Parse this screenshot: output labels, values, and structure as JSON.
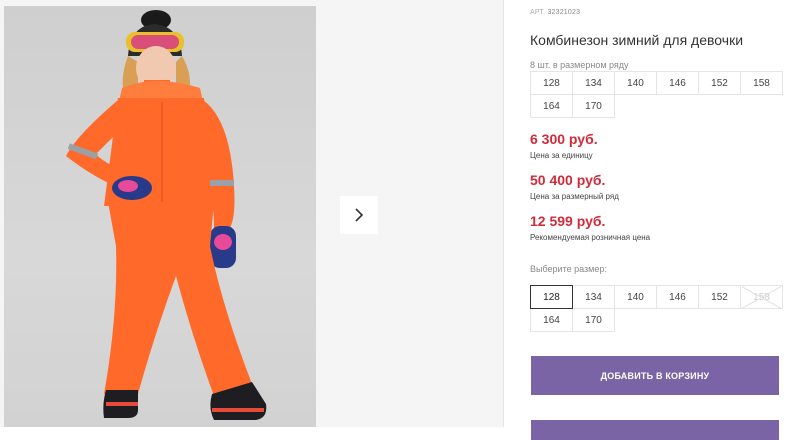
{
  "gallery": {
    "photo_alt": "",
    "next_icon": "chevron-right-icon"
  },
  "product": {
    "article_label": "АРТ.",
    "article_number": "32321023",
    "title": "Комбинезон зимний для девочки",
    "size_run_label": "8 шт. в размерном ряду",
    "size_run": [
      "128",
      "134",
      "140",
      "146",
      "152",
      "158",
      "164",
      "170"
    ]
  },
  "prices": [
    {
      "value": "6 300 руб.",
      "note": "Цена за единицу"
    },
    {
      "value": "50 400 руб.",
      "note": "Цена за размерный ряд"
    },
    {
      "value": "12 599 руб.",
      "note": "Рекомендуемая розничная цена"
    }
  ],
  "size_select": {
    "label": "Выберите размер:",
    "options": [
      "128",
      "134",
      "140",
      "146",
      "152",
      "158",
      "164",
      "170"
    ],
    "selected": "128",
    "disabled": [
      "158"
    ]
  },
  "actions": {
    "add_to_cart": "ДОБАВИТЬ В КОРЗИНУ"
  },
  "colors": {
    "price": "#d22a3a",
    "button": "#7b64a6",
    "suit": "#ff6a2b"
  }
}
